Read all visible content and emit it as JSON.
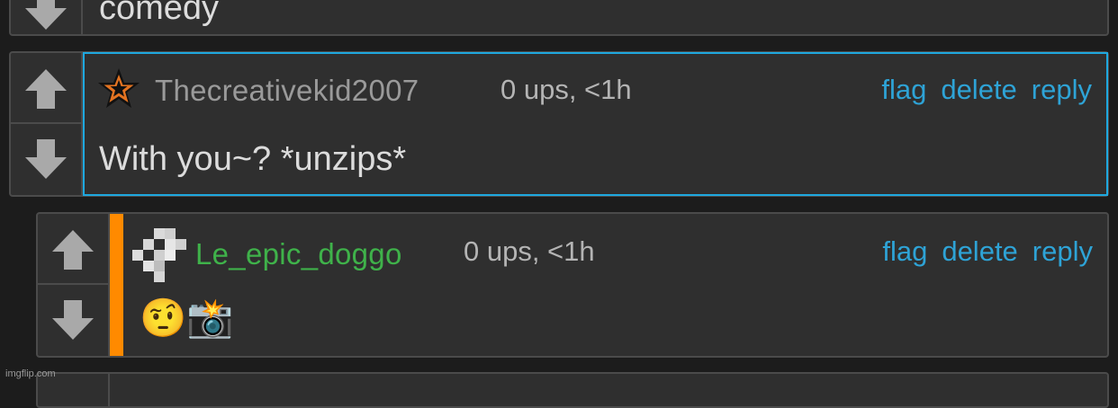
{
  "top_comment": {
    "text": "comedy"
  },
  "comment1": {
    "username": "Thecreativekid2007",
    "meta": "0 ups, <1h",
    "text": "With you~? *unzips*",
    "actions": {
      "flag": "flag",
      "delete": "delete",
      "reply": "reply"
    },
    "username_color": "#9a9a9a",
    "highlight_border": "#1ea8df"
  },
  "comment2": {
    "username": "Le_epic_doggo",
    "meta": "0 ups, <1h",
    "text": "🤨📸",
    "actions": {
      "flag": "flag",
      "delete": "delete",
      "reply": "reply"
    },
    "username_color": "#3fb24a",
    "reply_bar_color": "#ff8a00"
  },
  "watermark": "imgflip.com",
  "icons": {
    "upvote": "arrow-up-icon",
    "downvote": "arrow-down-icon",
    "badge": "star-icon",
    "avatar": "pixel-avatar-icon"
  }
}
